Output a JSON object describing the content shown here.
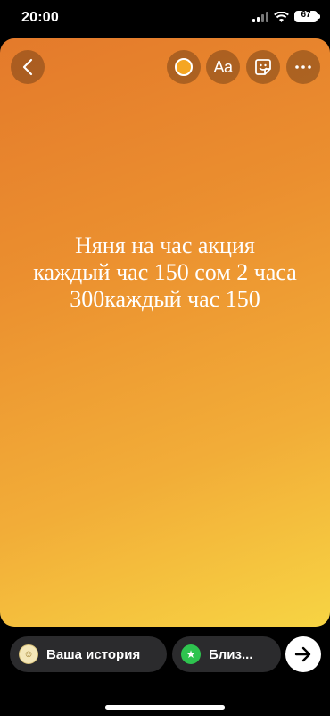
{
  "statusbar": {
    "time": "20:00",
    "battery": "67"
  },
  "toolbar": {
    "back_icon": "chevron-left-icon",
    "color_icon": "color-picker-icon",
    "color_value": "#f5a623",
    "text_label": "Aa",
    "sticker_icon": "sticker-icon",
    "more_icon": "more-icon"
  },
  "story": {
    "background_colors": [
      "#e47a2b",
      "#f7d443"
    ],
    "text_lines": [
      "Няня на час акция",
      "каждый час 150 сом 2 часа",
      "300каждый час 150"
    ]
  },
  "bottom": {
    "your_story_label": "Ваша история",
    "close_friends_label": "Близ...",
    "send_icon": "arrow-right-icon"
  }
}
